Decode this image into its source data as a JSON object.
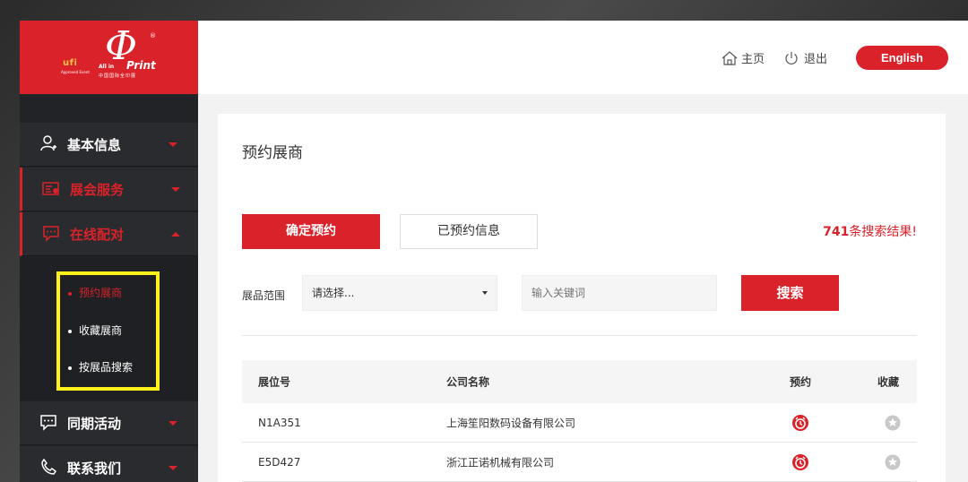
{
  "colors": {
    "accent": "#d9222a",
    "sidebar": "#222326",
    "highlight": "#fff21a"
  },
  "logo": {
    "ufi": "ufi",
    "ufi_sub": "Approved Event",
    "mark": "Φ",
    "reg": "®",
    "all_in": "All in",
    "print": "Print",
    "cn": "中国国际全印展"
  },
  "sidebar": {
    "items": [
      {
        "label": "基本信息",
        "icon": "user-plus-icon"
      },
      {
        "label": "展会服务",
        "icon": "service-card-icon"
      },
      {
        "label": "在线配对",
        "icon": "chat-dots-icon"
      },
      {
        "label": "同期活动",
        "icon": "chat-dots-icon"
      },
      {
        "label": "联系我们",
        "icon": "phone-icon"
      }
    ],
    "submenu": [
      {
        "label": "预约展商"
      },
      {
        "label": "收藏展商"
      },
      {
        "label": "按展品搜索"
      }
    ]
  },
  "topbar": {
    "home_label": "主页",
    "home_icon": "home-icon",
    "logout_label": "退出",
    "logout_icon": "power-icon",
    "english_label": "English"
  },
  "main": {
    "title": "预约展商",
    "confirm_button": "确定预约",
    "booked_button": "已预约信息",
    "result_count": "741",
    "result_suffix": "条搜索结果!",
    "filter_label": "展品范围",
    "select_value": "请选择...",
    "keyword_placeholder": "输入关键词",
    "search_button": "搜索",
    "table": {
      "headers": [
        "展位号",
        "公司名称",
        "预约",
        "收藏"
      ],
      "rows": [
        {
          "booth": "N1A351",
          "company": "上海笙阳数码设备有限公司"
        },
        {
          "booth": "E5D427",
          "company": "浙江正诺机械有限公司"
        }
      ]
    }
  }
}
